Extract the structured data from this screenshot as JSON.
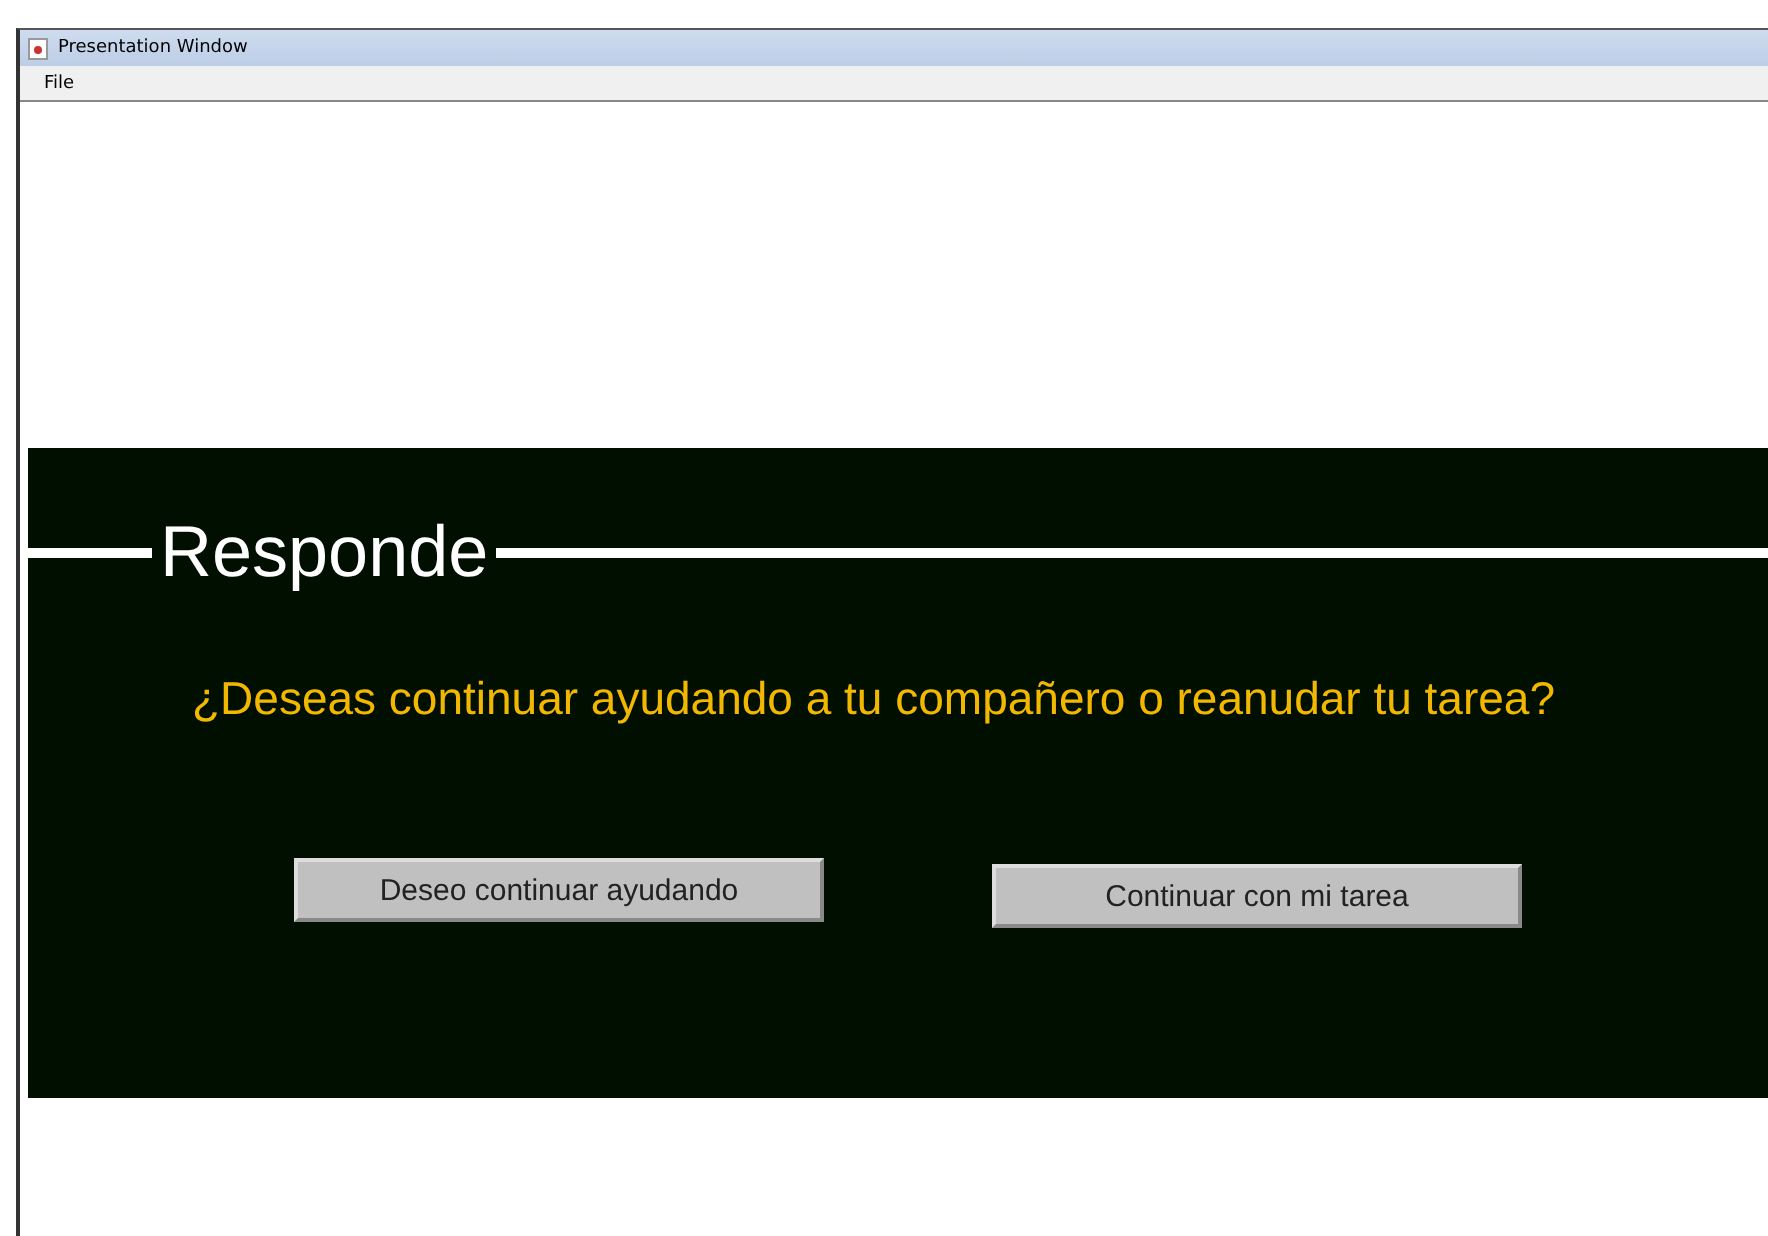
{
  "window": {
    "title": "Presentation Window"
  },
  "menu": [
    "File"
  ],
  "panel": {
    "title": "Responde",
    "question": "¿Deseas continuar ayudando a tu compañero o reanudar tu tarea?",
    "buttons": [
      "Deseo continuar ayudando",
      "Continuar con mi tarea"
    ]
  }
}
